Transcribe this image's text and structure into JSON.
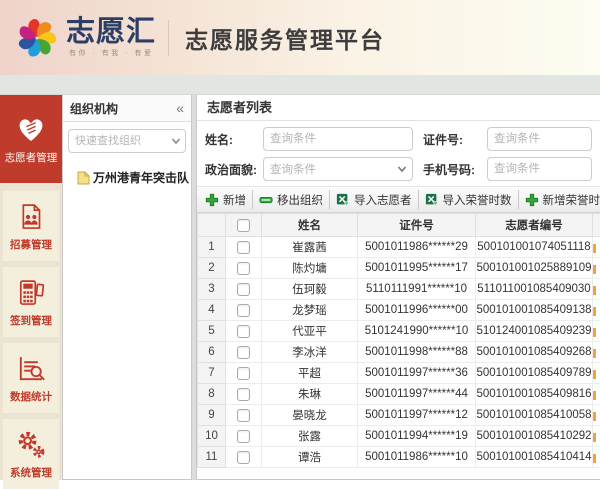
{
  "header": {
    "logo_text": "志愿汇",
    "logo_tagline": "有你 · 有我 · 有爱",
    "title": "志愿服务管理平台"
  },
  "colors": {
    "accent_red": "#bf3b2b",
    "toolbar_green": "#2fa33b",
    "excel_green": "#1e7145",
    "header_pink": "#efd3cb"
  },
  "sidebar": {
    "items": [
      {
        "label": "志愿者管理",
        "icon": "heart-hand-icon",
        "active": true
      },
      {
        "label": "招募管理",
        "icon": "recruit-book-icon",
        "active": false
      },
      {
        "label": "签到管理",
        "icon": "pos-terminal-icon",
        "active": false
      },
      {
        "label": "数据统计",
        "icon": "chart-magnifier-icon",
        "active": false
      },
      {
        "label": "系统管理",
        "icon": "gears-icon",
        "active": false
      }
    ]
  },
  "org_panel": {
    "title": "组织机构",
    "collapse_glyph": "«",
    "search_placeholder": "快速查找组织",
    "tree_items": [
      {
        "label": "万州港青年突击队"
      }
    ]
  },
  "main": {
    "title": "志愿者列表",
    "filters": {
      "name_label": "姓名:",
      "name_placeholder": "查询条件",
      "id_label": "证件号:",
      "id_placeholder": "查询条件",
      "political_label": "政治面貌:",
      "political_placeholder": "查询条件",
      "phone_label": "手机号码:",
      "phone_placeholder": "查询条件"
    },
    "toolbar": {
      "add": "新增",
      "remove_org": "移出组织",
      "import_volunteers": "导入志愿者",
      "import_honor_hours": "导入荣誉时数",
      "add_honor_hours": "新增荣誉时数"
    },
    "table": {
      "columns": [
        "姓名",
        "证件号",
        "志愿者编号"
      ],
      "rows": [
        {
          "num": "1",
          "name": "崔露茜",
          "id": "5001011986******29",
          "vol_no": "500101001074051118"
        },
        {
          "num": "2",
          "name": "陈灼墉",
          "id": "5001011995******17",
          "vol_no": "500101001025889109"
        },
        {
          "num": "3",
          "name": "伍珂毅",
          "id": "5110111991******10",
          "vol_no": "511011001085409030"
        },
        {
          "num": "4",
          "name": "龙梦瑶",
          "id": "5001011996******00",
          "vol_no": "500101001085409138"
        },
        {
          "num": "5",
          "name": "代亚平",
          "id": "5101241990******10",
          "vol_no": "510124001085409239"
        },
        {
          "num": "6",
          "name": "李冰洋",
          "id": "5001011998******88",
          "vol_no": "500101001085409268"
        },
        {
          "num": "7",
          "name": "平超",
          "id": "5001011997******36",
          "vol_no": "500101001085409789"
        },
        {
          "num": "8",
          "name": "朱琳",
          "id": "5001011997******44",
          "vol_no": "500101001085409816"
        },
        {
          "num": "9",
          "name": "晏晓龙",
          "id": "5001011997******12",
          "vol_no": "500101001085410058"
        },
        {
          "num": "10",
          "name": "张露",
          "id": "5001011994******19",
          "vol_no": "500101001085410292"
        },
        {
          "num": "11",
          "name": "谭浩",
          "id": "5001011986******10",
          "vol_no": "500101001085410414"
        }
      ]
    }
  }
}
